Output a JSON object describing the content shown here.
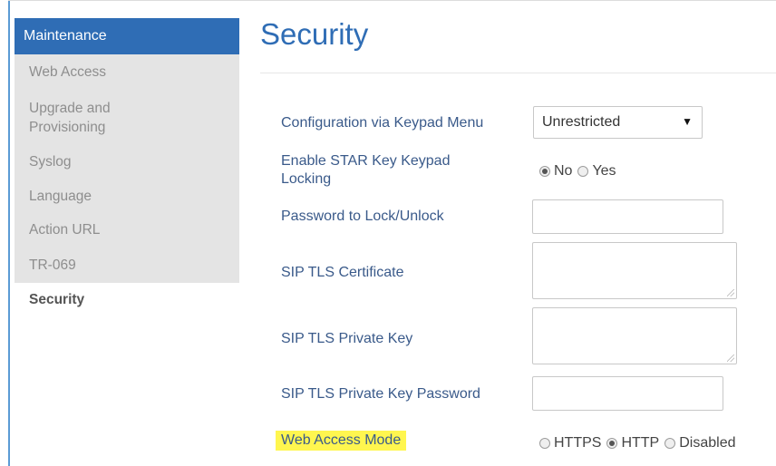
{
  "sidebar": {
    "header": "Maintenance",
    "items": [
      {
        "label": "Web Access"
      },
      {
        "label": "Upgrade and Provisioning"
      },
      {
        "label": "Syslog"
      },
      {
        "label": "Language"
      },
      {
        "label": "Action URL"
      },
      {
        "label": "TR-069"
      }
    ],
    "active": "Security"
  },
  "page": {
    "title": "Security"
  },
  "form": {
    "keypad_menu": {
      "label": "Configuration via Keypad Menu",
      "value": "Unrestricted",
      "arrow": "▼"
    },
    "star_lock": {
      "label": "Enable STAR Key Keypad Locking",
      "options": [
        "No",
        "Yes"
      ],
      "selected": "No"
    },
    "password_lock": {
      "label": "Password to Lock/Unlock",
      "value": ""
    },
    "tls_cert": {
      "label": "SIP TLS Certificate",
      "value": ""
    },
    "tls_key": {
      "label": "SIP TLS Private Key",
      "value": ""
    },
    "tls_key_password": {
      "label": "SIP TLS Private Key Password",
      "value": ""
    },
    "web_access_mode": {
      "label": "Web Access Mode",
      "options": [
        "HTTPS",
        "HTTP",
        "Disabled"
      ],
      "selected": "HTTP"
    }
  },
  "colors": {
    "accent": "#2f6db5",
    "highlight": "#fff64f",
    "sidebar_bg": "#e4e4e4"
  }
}
